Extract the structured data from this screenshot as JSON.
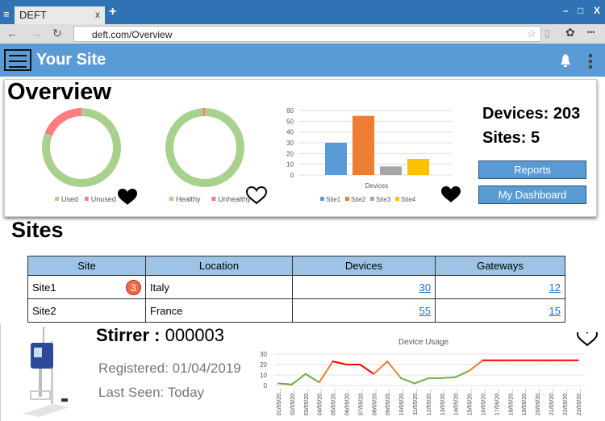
{
  "browser": {
    "tab_title": "DEFT",
    "tab_close": "x",
    "new_tab": "+",
    "url": "deft.com/Overview",
    "menu_icon": "≡",
    "min": "–",
    "max": "□",
    "close": "X",
    "more": "•••"
  },
  "app": {
    "site_name": "Your Site",
    "bell_icon": "bell-icon",
    "kebab_icon": "kebab-icon"
  },
  "overview": {
    "title": "Overview",
    "usage_donut": {
      "type": "pie",
      "series": [
        {
          "name": "Used",
          "value": 81,
          "color": "#a9d18e"
        },
        {
          "name": "Unused",
          "value": 19,
          "color": "#ff7c80"
        }
      ],
      "favorite": true
    },
    "health_donut": {
      "type": "pie",
      "series": [
        {
          "name": "Healthy",
          "value": 99,
          "color": "#a9d18e"
        },
        {
          "name": "Unhealthy",
          "value": 1,
          "color": "#ff7c80"
        }
      ],
      "favorite": false
    },
    "devices_chart": {
      "type": "bar",
      "xlabel": "Devices",
      "ylim": [
        0,
        60
      ],
      "yticks": [
        0,
        10,
        20,
        30,
        40,
        50,
        60
      ],
      "series": [
        {
          "name": "Site1",
          "value": 30,
          "color": "#5b9bd5"
        },
        {
          "name": "Site2",
          "value": 55,
          "color": "#ed7d31"
        },
        {
          "name": "Site3",
          "value": 8,
          "color": "#a5a5a5"
        },
        {
          "name": "Site4",
          "value": 15,
          "color": "#ffc000"
        }
      ],
      "favorite": true
    },
    "devices_label": "Devices: 203",
    "sites_label": "Sites: 5",
    "reports_button": "Reports",
    "dashboard_button": "My Dashboard"
  },
  "sites": {
    "title": "Sites",
    "columns": [
      "Site",
      "Location",
      "Devices",
      "Gateways"
    ],
    "rows": [
      {
        "site": "Site1",
        "badge": "3",
        "location": "Italy",
        "devices": "30",
        "gateways": "12"
      },
      {
        "site": "Site2",
        "badge": null,
        "location": "France",
        "devices": "55",
        "gateways": "15"
      }
    ]
  },
  "device": {
    "name_label": "Stirrer :",
    "name_id": "000003",
    "registered": "Registered: 01/04/2019",
    "last_seen": "Last Seen: Today",
    "favorite": false,
    "chart_data": {
      "type": "line",
      "title": "Device Usage",
      "ylim": [
        0,
        30
      ],
      "yticks": [
        0,
        10,
        20,
        30
      ],
      "x": [
        "01/05/20...",
        "02/05/20...",
        "03/05/20...",
        "04/05/20...",
        "05/05/20...",
        "06/05/20...",
        "07/05/20...",
        "08/05/20...",
        "09/05/20...",
        "10/05/20...",
        "11/05/20...",
        "12/05/20...",
        "13/05/20...",
        "14/05/20...",
        "15/05/20...",
        "16/05/20...",
        "17/05/20...",
        "18/05/20...",
        "19/05/20...",
        "20/05/20...",
        "21/05/20...",
        "22/05/20...",
        "23/05/20..."
      ],
      "values": [
        2,
        1,
        11,
        3,
        23,
        20,
        20,
        11,
        23,
        7,
        2,
        7,
        7,
        8,
        14,
        24,
        24,
        24,
        24,
        24,
        24,
        24,
        24
      ],
      "segment_colors": [
        "#70ad47",
        "#70ad47",
        "#70ad47",
        "#ed7d31",
        "#ff0000",
        "#ff0000",
        "#ff0000",
        "#ed7d31",
        "#ed7d31",
        "#70ad47",
        "#70ad47",
        "#70ad47",
        "#70ad47",
        "#70ad47",
        "#ed7d31",
        "#ff0000",
        "#ff0000",
        "#ff0000",
        "#ff0000",
        "#ff0000",
        "#ff0000",
        "#ff0000"
      ]
    }
  }
}
